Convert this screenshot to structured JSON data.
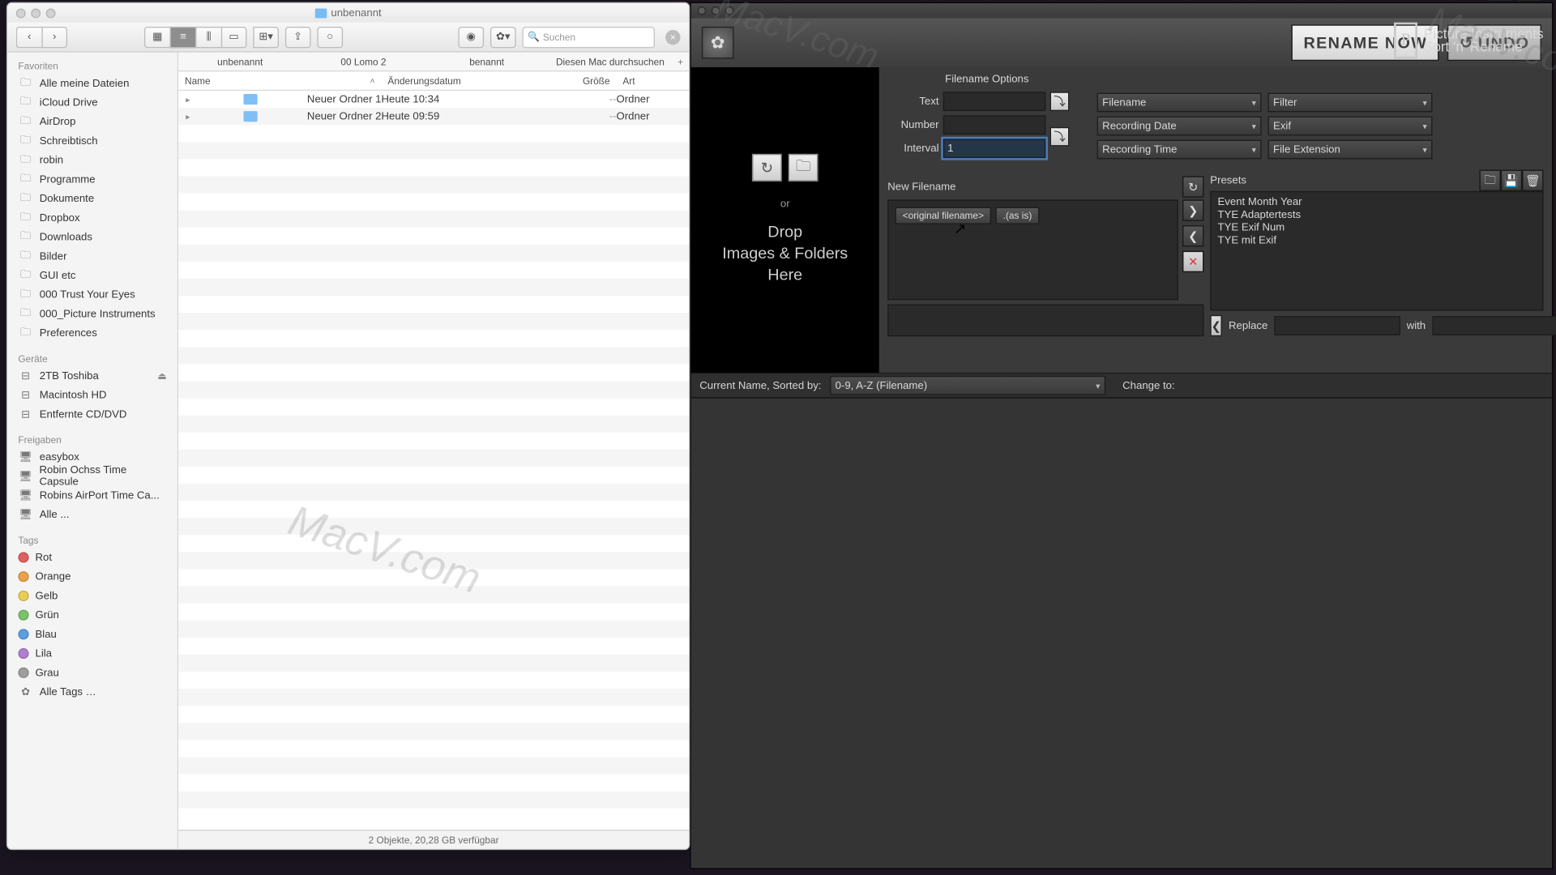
{
  "finder": {
    "title": "unbenannt",
    "search_placeholder": "Suchen",
    "pathbar": [
      "unbenannt",
      "00 Lomo 2",
      "benannt",
      "Diesen Mac durchsuchen"
    ],
    "columns": {
      "name": "Name",
      "date": "Änderungsdatum",
      "size": "Größe",
      "kind": "Art"
    },
    "rows": [
      {
        "name": "Neuer Ordner 1",
        "date": "Heute 10:34",
        "size": "--",
        "kind": "Ordner"
      },
      {
        "name": "Neuer Ordner 2",
        "date": "Heute 09:59",
        "size": "--",
        "kind": "Ordner"
      }
    ],
    "sidebar": {
      "favorites_title": "Favoriten",
      "favorites": [
        "Alle meine Dateien",
        "iCloud Drive",
        "AirDrop",
        "Schreibtisch",
        "robin",
        "Programme",
        "Dokumente",
        "Dropbox",
        "Downloads",
        "Bilder",
        "GUI etc",
        "000 Trust Your Eyes",
        "000_Picture Instruments",
        "Preferences"
      ],
      "devices_title": "Geräte",
      "devices": [
        {
          "name": "2TB Toshiba",
          "eject": true
        },
        {
          "name": "Macintosh HD",
          "eject": false
        },
        {
          "name": "Entfernte CD/DVD",
          "eject": false
        }
      ],
      "shares_title": "Freigaben",
      "shares": [
        "easybox",
        "Robin Ochss Time Capsule",
        "Robins AirPort Time Ca...",
        "Alle ..."
      ],
      "tags_title": "Tags",
      "tags": [
        {
          "label": "Rot",
          "color": "#e06060"
        },
        {
          "label": "Orange",
          "color": "#eba14a"
        },
        {
          "label": "Gelb",
          "color": "#e7cf55"
        },
        {
          "label": "Grün",
          "color": "#7ac36a"
        },
        {
          "label": "Blau",
          "color": "#5a9fe0"
        },
        {
          "label": "Lila",
          "color": "#b07fd0"
        },
        {
          "label": "Grau",
          "color": "#9e9e9e"
        }
      ],
      "all_tags": "Alle Tags …"
    },
    "status": "2 Objekte, 20,28 GB verfügbar"
  },
  "app": {
    "rename_btn": "RENAME   NOW",
    "undo_btn": "UNDO",
    "brand_line1": "Picture Instruments",
    "brand_line2": "Sort 'n' Rename",
    "dropzone_line1": "Drop",
    "dropzone_line2": "Images & Folders",
    "dropzone_line3": "Here",
    "dropzone_or": "or",
    "filename_options": "Filename Options",
    "labels": {
      "text": "Text",
      "number": "Number",
      "interval": "Interval"
    },
    "interval_value": "1",
    "combos_left": [
      "Filename",
      "Recording Date",
      "Recording Time"
    ],
    "combos_right": [
      "Filter",
      "Exif",
      "File Extension"
    ],
    "new_filename": "New Filename",
    "presets_title": "Presets",
    "tag_original": "<original filename>",
    "tag_asis": ".(as is)",
    "presets": [
      "Event Month Year",
      "TYE Adaptertests",
      "TYE Exif Num",
      "TYE mit Exif"
    ],
    "replace_label": "Replace",
    "with_label": "with",
    "sort_label": "Current Name, Sorted by:",
    "sort_value": "0-9, A-Z (Filename)",
    "change_to": "Change to:"
  },
  "watermark": "MacV.com"
}
